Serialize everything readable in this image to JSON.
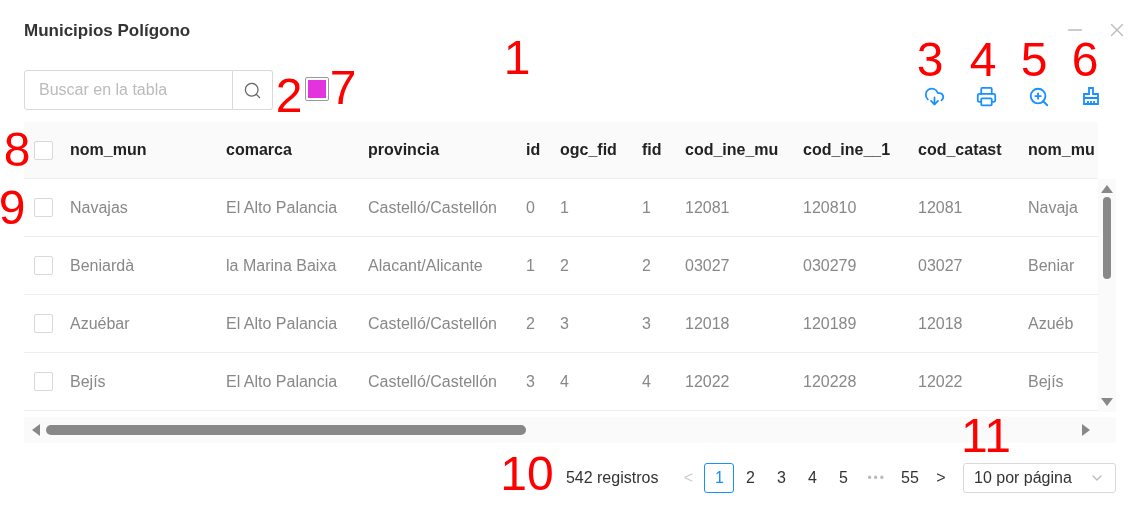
{
  "window": {
    "title": "Municipios Polígono"
  },
  "search": {
    "placeholder": "Buscar en la tabla"
  },
  "color_swatch": {
    "color": "#e233df"
  },
  "table": {
    "select_all": {
      "checked": false
    },
    "columns": [
      "nom_mun",
      "comarca",
      "provincia",
      "id",
      "ogc_fid",
      "fid",
      "cod_ine_mu",
      "cod_ine__1",
      "cod_catast",
      "nom_mu"
    ],
    "rows": [
      {
        "checked": false,
        "cells": [
          "Navajas",
          "El Alto Palancia",
          "Castelló/Castellón",
          "0",
          "1",
          "1",
          "12081",
          "120810",
          "12081",
          "Navaja"
        ]
      },
      {
        "checked": false,
        "cells": [
          "Beniardà",
          "la Marina Baixa",
          "Alacant/Alicante",
          "1",
          "2",
          "2",
          "03027",
          "030279",
          "03027",
          "Beniar"
        ]
      },
      {
        "checked": false,
        "cells": [
          "Azuébar",
          "El Alto Palancia",
          "Castelló/Castellón",
          "2",
          "3",
          "3",
          "12018",
          "120189",
          "12018",
          "Azuéb"
        ]
      },
      {
        "checked": false,
        "cells": [
          "Bejís",
          "El Alto Palancia",
          "Castelló/Castellón",
          "3",
          "4",
          "4",
          "12022",
          "120228",
          "12022",
          "Bejís"
        ]
      }
    ]
  },
  "pagination": {
    "total": "542 registros",
    "prev": {
      "label": "<",
      "disabled": true
    },
    "pages": [
      {
        "label": "1",
        "selected": true
      },
      {
        "label": "2",
        "selected": false
      },
      {
        "label": "3",
        "selected": false
      },
      {
        "label": "4",
        "selected": false
      },
      {
        "label": "5",
        "selected": false
      },
      {
        "label": "•••",
        "kind": "ellipsis",
        "selected": false
      },
      {
        "label": "55",
        "selected": false
      }
    ],
    "next": {
      "label": ">",
      "disabled": false
    },
    "page_size": "10 por página"
  },
  "callouts": [
    "1",
    "2",
    "3",
    "4",
    "5",
    "6",
    "7",
    "8",
    "9",
    "10",
    "11"
  ]
}
